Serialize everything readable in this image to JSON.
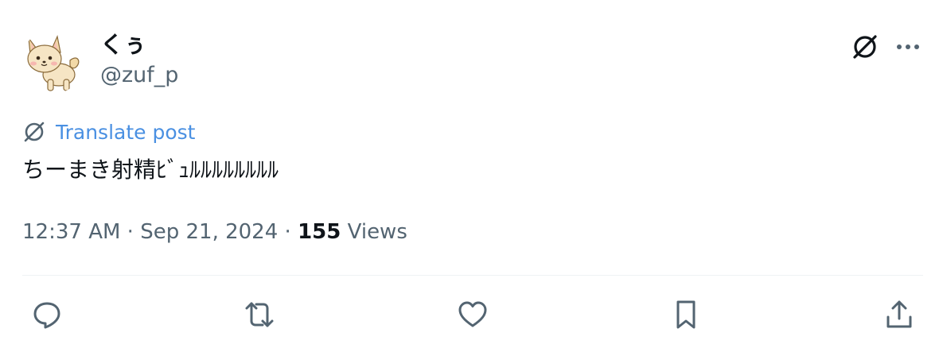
{
  "author": {
    "display_name": "くぅ",
    "handle": "@zuf_p"
  },
  "translate": {
    "label": "Translate post",
    "icon": "translate-icon"
  },
  "post": {
    "text": "ちーまき射精ﾋﾞｭﾙﾙﾙﾙﾙﾙﾙﾙ"
  },
  "meta": {
    "time": "12:37 AM",
    "separator1": " · ",
    "date": "Sep 21, 2024",
    "separator2": " · ",
    "views_count": "155",
    "views_label": " Views"
  },
  "actions": [
    {
      "name": "reply",
      "icon": "reply-icon"
    },
    {
      "name": "repost",
      "icon": "repost-icon"
    },
    {
      "name": "like",
      "icon": "heart-icon"
    },
    {
      "name": "bookmark",
      "icon": "bookmark-icon"
    },
    {
      "name": "share",
      "icon": "share-icon"
    }
  ],
  "colors": {
    "text": "#0f1419",
    "secondary": "#536471",
    "link": "#4a90e2",
    "divider": "#eff3f4"
  }
}
